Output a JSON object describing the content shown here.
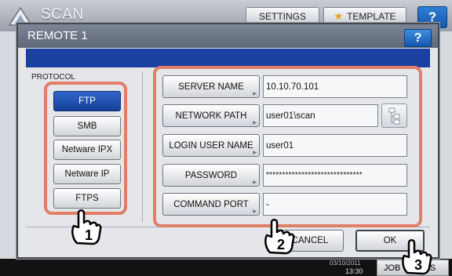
{
  "app": {
    "title": "SCAN",
    "settings_label": "SETTINGS",
    "template_label": "TEMPLATE",
    "help_label": "?",
    "job_status_label": "JOB STATUS",
    "time": "13:30",
    "date": "03/10/2011"
  },
  "dialog": {
    "title": "REMOTE 1",
    "help_label": "?",
    "protocol_label": "PROTOCOL",
    "protocols": [
      {
        "label": "FTP",
        "selected": true
      },
      {
        "label": "SMB",
        "selected": false
      },
      {
        "label": "Netware IPX",
        "selected": false
      },
      {
        "label": "Netware IP",
        "selected": false
      },
      {
        "label": "FTPS",
        "selected": false
      }
    ],
    "server_name": {
      "label": "SERVER NAME",
      "value": "10.10.70.101"
    },
    "network_path": {
      "label": "NETWORK PATH",
      "value": "user01\\scan"
    },
    "login_user_name": {
      "label": "LOGIN USER NAME",
      "value": "user01"
    },
    "password": {
      "label": "PASSWORD",
      "value": "******************************"
    },
    "command_port": {
      "label": "COMMAND PORT",
      "value": "-"
    },
    "cancel_label": "CANCEL",
    "ok_label": "OK"
  },
  "callouts": [
    "1",
    "2",
    "3"
  ],
  "colors": {
    "highlight": "#e27e68",
    "selected_button": "#1f4fb0",
    "header_band": "#1c3fa2"
  }
}
